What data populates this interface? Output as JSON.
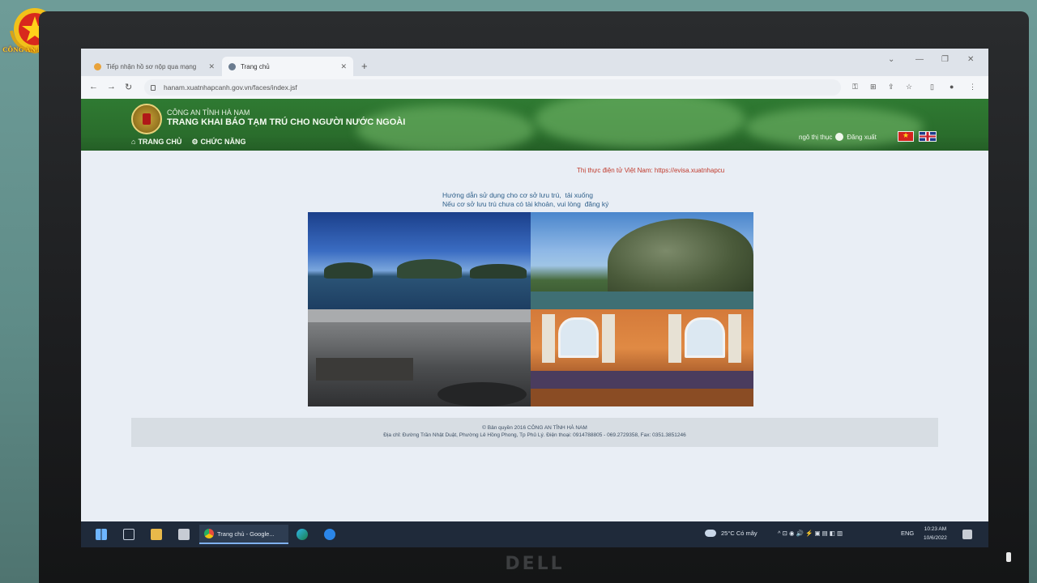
{
  "watermark": {
    "text": "CÔNG AN HÀ NAM"
  },
  "browser": {
    "tabs": [
      {
        "label": "Tiếp nhận hồ sơ nộp qua mạng",
        "active": false
      },
      {
        "label": "Trang chủ",
        "active": true
      }
    ],
    "url": "hanam.xuatnhapcanh.gov.vn/faces/index.jsf"
  },
  "site": {
    "org": "CÔNG AN TỈNH HÀ NAM",
    "title": "TRANG KHAI BÁO TẠM TRÚ CHO NGƯỜI NƯỚC NGOÀI",
    "nav": [
      {
        "label": "TRANG CHỦ",
        "icon": "home-icon"
      },
      {
        "label": "CHỨC NĂNG",
        "icon": "gear-icon"
      }
    ],
    "user": "ngô thị thục",
    "logout": "Đăng xuất",
    "colors": {
      "header": "#2a6d2c",
      "link": "#2e5f8a",
      "visa": "#c0392b"
    }
  },
  "content": {
    "visa_text": "Thị thực điện tử Việt Nam: https://evisa.xuatnhapcu",
    "guide_line1": "Hướng dẫn sử dụng cho cơ sở lưu trú,",
    "guide_link1": "tải xuống",
    "guide_line2": "Nếu cơ sở lưu trú chưa có tài khoản, vui lòng",
    "guide_link2": "đăng ký",
    "footer_line1": "© Bản quyền 2016 CÔNG AN TỈNH HÀ NAM",
    "footer_line2": "Địa chỉ: Đường Trần Nhật Duật, Phường Lê Hồng Phong, Tp Phủ Lý. Điện thoại: 0914788805 - 069.2729358, Fax: 0351.3851246"
  },
  "taskbar": {
    "app_label": "Trang chủ - Google...",
    "weather": "25°C Có mây",
    "lang": "ENG",
    "time": "10:23 AM",
    "date": "10/6/2022"
  },
  "monitor": {
    "brand": "DELL"
  }
}
